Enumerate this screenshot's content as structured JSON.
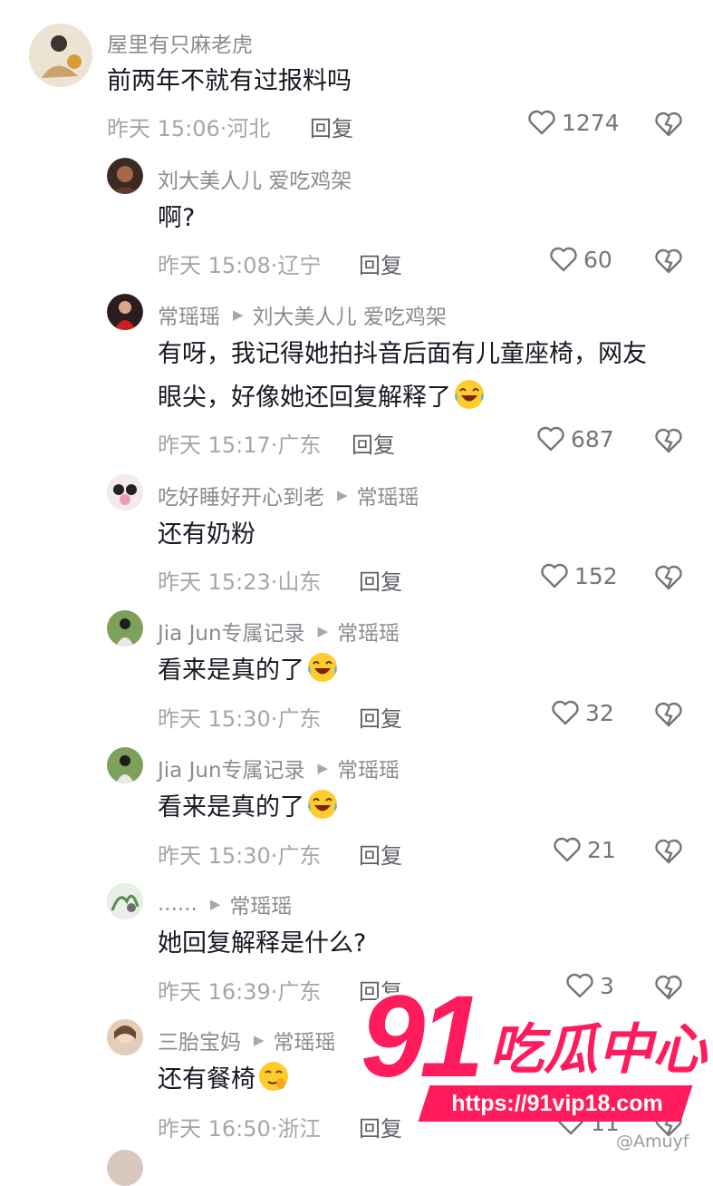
{
  "comments": [
    {
      "id": "c1",
      "user": "屋里有只麻老虎",
      "reply_to": "",
      "text": "前两年不就有过报料吗",
      "text2": "",
      "emoji": "",
      "time": "昨天 15:06",
      "region": "河北",
      "reply": "回复",
      "likes": "1274"
    },
    {
      "id": "c2",
      "user": "刘大美人儿 爱吃鸡架",
      "reply_to": "",
      "text": "啊?",
      "text2": "",
      "emoji": "",
      "time": "昨天 15:08",
      "region": "辽宁",
      "reply": "回复",
      "likes": "60"
    },
    {
      "id": "c3",
      "user": "常瑶瑶",
      "reply_to": "刘大美人儿 爱吃鸡架",
      "text": "有呀，我记得她拍抖音后面有儿童座椅，网友",
      "text2": "眼尖，好像她还回复解释了",
      "emoji": "laugh-cry",
      "time": "昨天 15:17",
      "region": "广东",
      "reply": "回复",
      "likes": "687"
    },
    {
      "id": "c4",
      "user": "吃好睡好开心到老",
      "reply_to": "常瑶瑶",
      "text": "还有奶粉",
      "text2": "",
      "emoji": "",
      "time": "昨天 15:23",
      "region": "山东",
      "reply": "回复",
      "likes": "152"
    },
    {
      "id": "c5",
      "user": "Jia Jun专属记录",
      "reply_to": "常瑶瑶",
      "text": "看来是真的了",
      "text2": "",
      "emoji": "laugh-cry",
      "time": "昨天 15:30",
      "region": "广东",
      "reply": "回复",
      "likes": "32"
    },
    {
      "id": "c6",
      "user": "Jia Jun专属记录",
      "reply_to": "常瑶瑶",
      "text": "看来是真的了",
      "text2": "",
      "emoji": "laugh-cry",
      "time": "昨天 15:30",
      "region": "广东",
      "reply": "回复",
      "likes": "21"
    },
    {
      "id": "c7",
      "user": "......",
      "reply_to": "常瑶瑶",
      "text": "她回复解释是什么?",
      "text2": "",
      "emoji": "",
      "time": "昨天 16:39",
      "region": "广东",
      "reply": "回复",
      "likes": "3"
    },
    {
      "id": "c8",
      "user": "三胎宝妈",
      "reply_to": "常瑶瑶",
      "text": "还有餐椅",
      "text2": "",
      "emoji": "hush",
      "time": "昨天 16:50",
      "region": "浙江",
      "reply": "回复",
      "likes": "11"
    }
  ],
  "watermark": {
    "number": "91",
    "title": "吃瓜中心",
    "url": "https://91vip18.com",
    "handle": "@Amuyf"
  },
  "icons": {
    "like": "heart-outline-icon",
    "dislike": "broken-heart-icon",
    "reply_arrow": "triangle-right-icon"
  }
}
